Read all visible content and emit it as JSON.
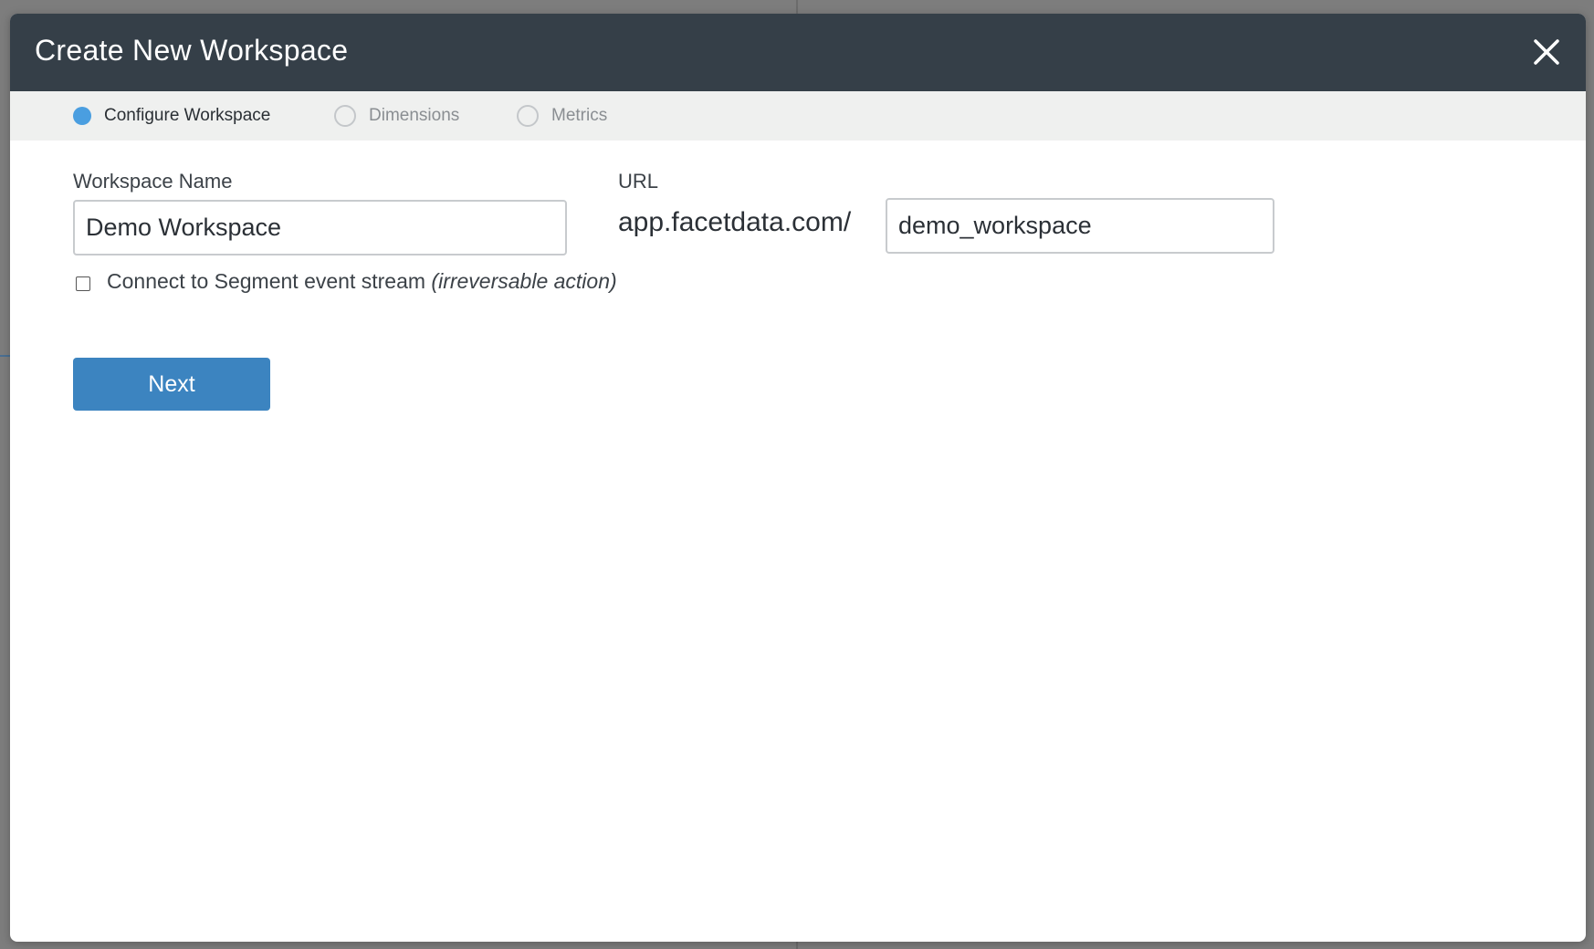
{
  "modal": {
    "title": "Create New Workspace",
    "close_icon": "close-icon"
  },
  "steps": [
    {
      "label": "Configure Workspace",
      "state": "active"
    },
    {
      "label": "Dimensions",
      "state": "inactive"
    },
    {
      "label": "Metrics",
      "state": "inactive"
    }
  ],
  "form": {
    "workspace_name_label": "Workspace Name",
    "workspace_name_value": "Demo Workspace",
    "url_label": "URL",
    "url_prefix": "app.facetdata.com/",
    "url_slug_value": "demo_workspace",
    "segment_checkbox_label": "Connect to Segment event stream",
    "segment_checkbox_note": "(irreversable action)",
    "segment_checked": false,
    "next_label": "Next"
  },
  "colors": {
    "header_bg": "#353f48",
    "step_bar_bg": "#eff0ef",
    "active_step": "#4a9ee0",
    "primary_button": "#3c84c0"
  }
}
